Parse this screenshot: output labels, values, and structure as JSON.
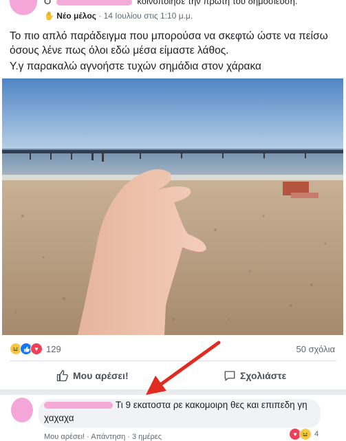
{
  "post": {
    "header_prefix": "Ο",
    "header_suffix": "κοινοποίησε την πρώτη του δημοσίευση.",
    "member_badge": "Νέο μέλος",
    "date": "· 14 Ιουλίου στις 1:10 μ.μ.",
    "text_line1": "Το πιο απλό παράδειγμα που μπορούσα να σκεφτώ ώστε να πείσω όσους λένε πως όλοι εδώ μέσα είμαστε λάθος.",
    "text_line2": "Υ.γ παρακαλώ αγνοήστε τυχών σημάδια στον χάρακα"
  },
  "stats": {
    "reaction_count": "129",
    "comments_count": "50 σχόλια"
  },
  "actions": {
    "like_label": "Μου αρέσει!",
    "comment_label": "Σχολιάστε"
  },
  "comment": {
    "text_line1": "Τι 9 εκατοστα ρε κακομοιρη θες και επιπεδη γη",
    "text_line2": "χαχαχα",
    "actions_text": "Μου αρέσει! · Απάντηση · 3 ημέρες",
    "reaction_count": "4"
  },
  "colors": {
    "brand_blue": "#1877f2",
    "arrow_red": "#e02b20",
    "redaction_pink": "#f3a2d6"
  },
  "icons": [
    "globe-icon",
    "thumbs-up-icon",
    "comment-icon",
    "haha-reaction-icon",
    "like-reaction-icon",
    "love-reaction-icon"
  ]
}
